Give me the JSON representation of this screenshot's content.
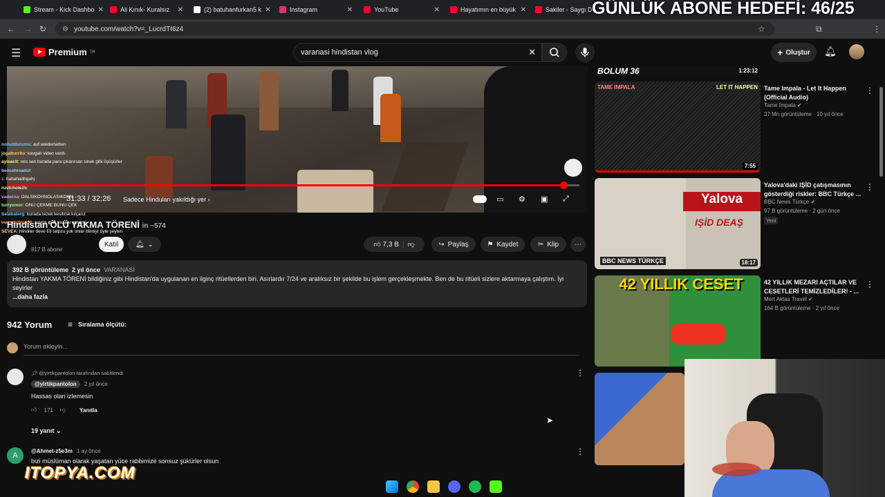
{
  "browser": {
    "tabs": [
      {
        "label": "Stream - Kick Dashbo",
        "color": "#53fc18"
      },
      {
        "label": "Ali Kınık- Kuralsız",
        "color": "#ff0033"
      },
      {
        "label": "(2) batuhanfurkan5 k",
        "color": "#ffffff"
      },
      {
        "label": "Instagram",
        "color": "#e1306c"
      },
      {
        "label": "YouTube",
        "color": "#ff0033"
      },
      {
        "label": "Hayatımın en büyük",
        "color": "#ff0033"
      },
      {
        "label": "Sakiler - Saygı Duru",
        "color": "#ff0033"
      }
    ],
    "url": "youtube.com/watch?v=_LucrdTI6z4"
  },
  "overlay": {
    "goal": "GÜNLÜK ABONE HEDEFİ: 46/25",
    "itopya": "ITOPYA.COM"
  },
  "youtube": {
    "logo_label": "Premium",
    "logo_sup": "TR",
    "search_value": "varanasi hindistan vlog",
    "create_label": "Oluştur"
  },
  "player": {
    "time": "31:33 / 32:26",
    "chapter": "Sadece Hinduları yakıldığı yer",
    "progress": 0.972
  },
  "chat": [
    {
      "user": "nohutdurumu",
      "text": ": auf wiedersehen",
      "color": "#6cf"
    },
    {
      "user": "jogaburrito",
      "text": ": kavgalı video vardı",
      "color": "#fc6"
    },
    {
      "user": "ayisacit",
      "text": ": reis sen burada para çıkarırsan sinek gibi üşüşürler",
      "color": "#ff6"
    },
    {
      "user": "bencetesaduf",
      "text": ":",
      "color": "#9cf"
    },
    {
      "user": "z",
      "text": ": hahahadhgahj",
      "color": "#f6c"
    },
    {
      "user": "rustchole25",
      "text": ":",
      "color": "#cfc"
    },
    {
      "user": "vaderna",
      "text": ": OALSIKDHNOLASIKDHN",
      "color": "#c9f"
    },
    {
      "user": "turryomor",
      "text": ": ONU ÇEKME BUNU ÇEK",
      "color": "#9f9"
    },
    {
      "user": "Selabaterg",
      "text": ": burada tezek kesilirsk kılçarız",
      "color": "#6cf"
    },
    {
      "user": "warmachine96",
      "text": ": kavga çıktı yazanı acsana",
      "color": "#f96"
    },
    {
      "user": "SEVEA",
      "text": ": Hindiler deve Eli tatpzu yok onlar bilmiyr öyle şeyleri",
      "color": "#fc9"
    }
  ],
  "video": {
    "title": "Hindistan'ÖLÜ YAKMA TÖRENİ",
    "viewers": "in ~574",
    "subs": "817 B abone",
    "join_label": "Katıl",
    "likes": "7,3 B",
    "share_label": "Paylaş",
    "save_label": "Kaydet",
    "clip_label": "Klip",
    "views": "392 B görüntüleme",
    "age": "2 yıl önce",
    "tag": "VARANASİ",
    "description": "Hindistan YAKMA TÖRENİ bildiğiniz gibi Hindistan'da uygulanan en ilginç ritüellerden biri. Asırlardır 7/24 ve aralıksız bir şekilde bu işlem gerçekleşmekte. Ben de bu ritüeli sizlere aktarmaya çalıştım. İyi seyirler",
    "more": "...daha fazla"
  },
  "comments": {
    "count": "942 Yorum",
    "sort_label": "Sıralama ölçütü:",
    "add_placeholder": "Yorum ekleyin...",
    "items": [
      {
        "pinned": "@yirtikpantolon tarafından sabitlendi",
        "author": "@yirtikpantolon",
        "age": "2 yıl önce",
        "text": "Hassas olan izlemesin",
        "likes": "171",
        "reply_label": "Yanıtla",
        "replies": "19 yanıt"
      },
      {
        "author": "@Ahmet-z5e3m",
        "age": "1 ay önce",
        "text": "bizi müslüman olarak yaşatan yüce rabbimize sonsuz şükürler olsun",
        "avatar_letter": "A"
      }
    ]
  },
  "sidebar": [
    {
      "title": "Tame Impala - Let It Happen (Official Audio)",
      "channel": "Tame Impala",
      "meta": "37 Mn görüntüleme · 10 yıl önce",
      "duration": "7:55",
      "thumb_left": "TAME IMPALA",
      "thumb_right": "LET IT HAPPEN",
      "top_label": "BOLUM 36",
      "top_dur": "1:23:12"
    },
    {
      "title": "Yalova'daki IŞİD çatışmasının gösterdiği riskler: BBC Türkçe ...",
      "channel": "BBC News Türkçe",
      "meta": "97 B görüntüleme · 2 gün önce",
      "badge": "Yeni",
      "duration": "18:17",
      "thumb_big": "Yalova",
      "thumb_sub": "IŞİD DEAŞ",
      "thumb_brand": "BBC NEWS TÜRKÇE"
    },
    {
      "title": "42 YILLIK MEZARI AÇTILAR VE CESETLERİ TEMİZLEDİLER! - ...",
      "channel": "Mert Aktas Travel",
      "meta": "164 B görüntüleme · 2 yıl önce",
      "thumb_big": "42 YILLIK CESET"
    }
  ]
}
